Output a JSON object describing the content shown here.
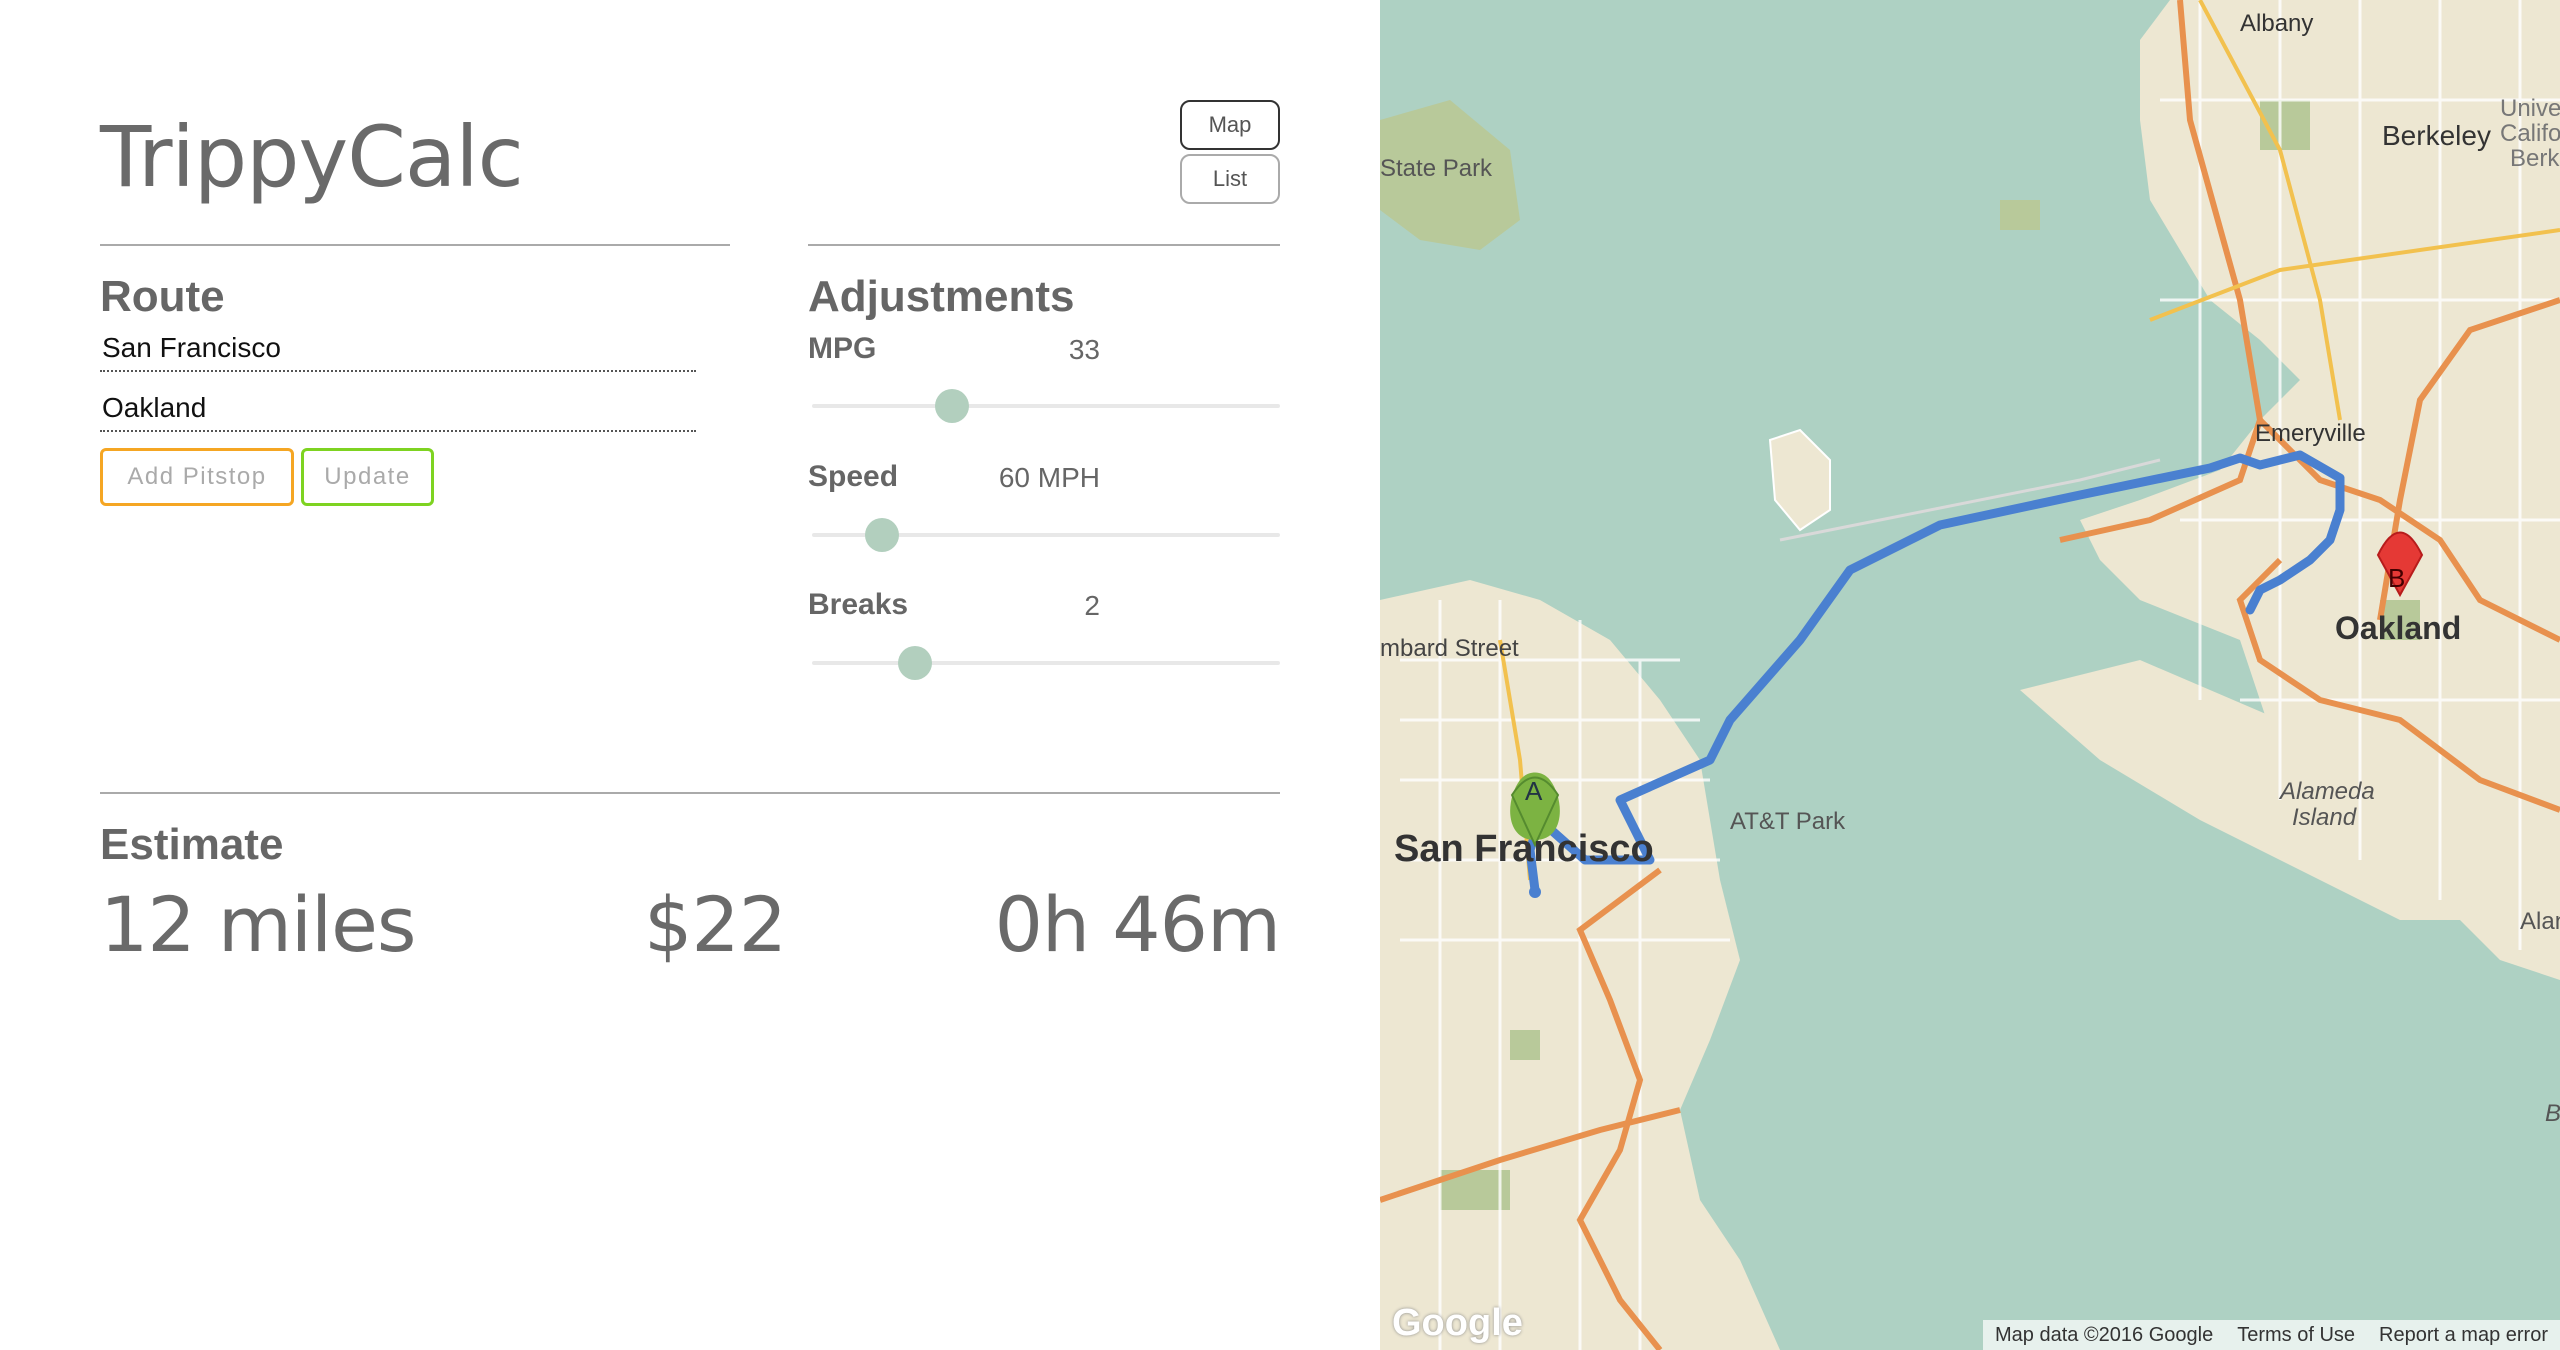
{
  "app": {
    "title": "TrippyCalc"
  },
  "view_toggle": {
    "map_label": "Map",
    "list_label": "List"
  },
  "route": {
    "heading": "Route",
    "origin_value": "San Francisco",
    "destination_value": "Oakland",
    "add_pitstop_label": "Add Pitstop",
    "update_label": "Update",
    "add_pitstop_color": "#f5a623",
    "update_color": "#7ed321"
  },
  "adjustments": {
    "heading": "Adjustments",
    "items": [
      {
        "label": "MPG",
        "value": "33",
        "slider_fraction": 0.3
      },
      {
        "label": "Speed",
        "value": "60 MPH",
        "slider_fraction": 0.15
      },
      {
        "label": "Breaks",
        "value": "2",
        "slider_fraction": 0.22
      }
    ]
  },
  "estimate": {
    "heading": "Estimate",
    "distance": "12 miles",
    "cost": "$22",
    "duration": "0h 46m"
  },
  "map": {
    "labels": {
      "albany": "Albany",
      "berkeley": "Berkeley",
      "univ": "Univer",
      "calif": "Califo",
      "berk": "Berk",
      "state_park": "State Park",
      "emeryville": "Emeryville",
      "oakland": "Oakland",
      "lombard": "mbard Street",
      "sf": "San Francisco",
      "att": "AT&T Park",
      "alameda": "Alameda",
      "island": "Island",
      "alan": "Alan",
      "b_edge": "B"
    },
    "marker_a": "A",
    "marker_b": "B",
    "google_logo": "Google",
    "footer": {
      "map_data": "Map data ©2016 Google",
      "terms": "Terms of Use",
      "report": "Report a map error"
    },
    "colors": {
      "water": "#aed1c3",
      "land": "#ede7d2",
      "park": "#b8c99a",
      "route": "#4a80d0",
      "highway": "#e8914e",
      "marker_a": "#7cb342",
      "marker_b": "#e53935"
    }
  }
}
